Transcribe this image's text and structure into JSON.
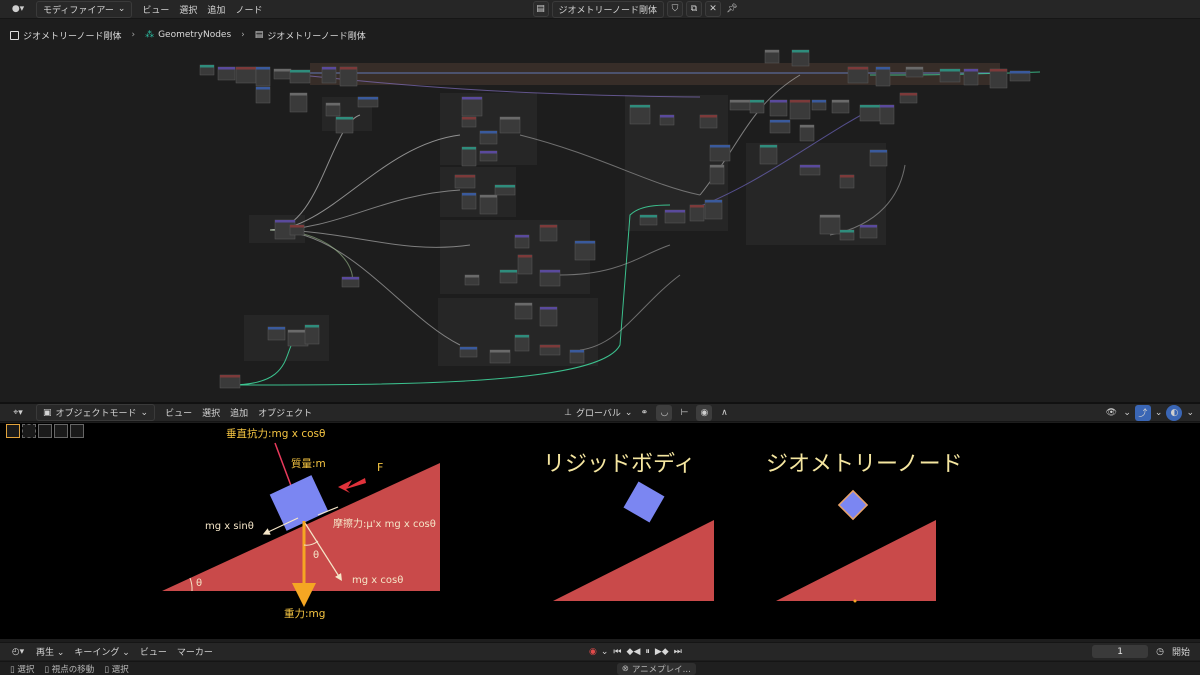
{
  "top_header": {
    "editor_mode": "モディファイアー",
    "menus": [
      "ビュー",
      "選択",
      "追加",
      "ノード"
    ],
    "node_tree_name": "ジオメトリーノード剛体"
  },
  "breadcrumb": {
    "items": [
      "ジオメトリーノード剛体",
      "GeometryNodes",
      "ジオメトリーノード剛体"
    ]
  },
  "viewport_header": {
    "mode": "オブジェクトモード",
    "menus": [
      "ビュー",
      "選択",
      "追加",
      "オブジェクト"
    ],
    "transform_orientation": "グローバル"
  },
  "diagram": {
    "normal_force": "垂直抗力:mg x cosθ",
    "mass": "質量:m",
    "force": "F",
    "sin_component": "mg x sinθ",
    "friction": "摩擦力:μ'x mg x cosθ",
    "theta_top": "θ",
    "cos_component": "mg x cosθ",
    "theta_base": "θ",
    "gravity": "重力:mg"
  },
  "examples": {
    "rigid_body_title": "リジッドボディ",
    "geometry_node_title": "ジオメトリーノード"
  },
  "colors": {
    "slope": "#c94a4a",
    "box": "#7b86f2",
    "label_gold": "#f5c542",
    "arrow_red": "#e0323b",
    "normal_line": "#e83a5c"
  },
  "timeline_header": {
    "playback": "再生",
    "keying": "キーイング",
    "menus": [
      "ビュー",
      "マーカー"
    ],
    "current_frame": "1",
    "start_label": "開始"
  },
  "status_bar": {
    "items": [
      "選択",
      "視点の移動",
      "選択"
    ],
    "notification": "アニメプレイ..."
  }
}
